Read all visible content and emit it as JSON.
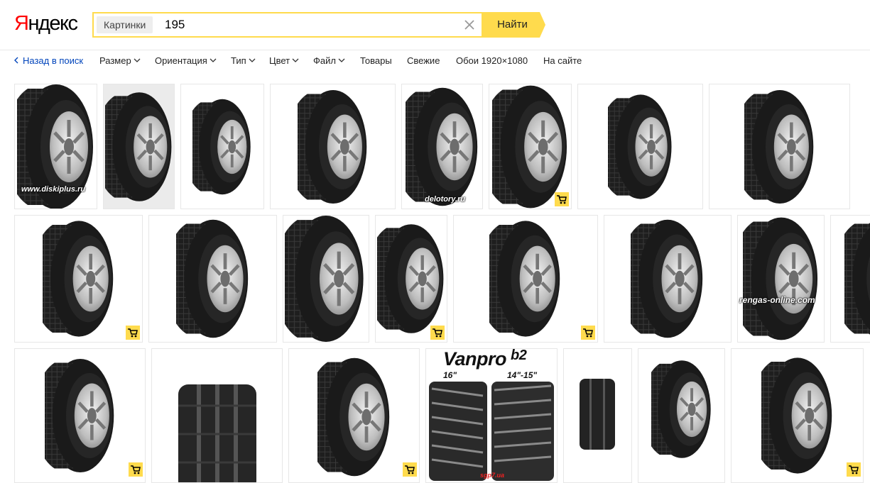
{
  "header": {
    "logo_first": "Я",
    "logo_rest": "ндекс",
    "search_scope": "Картинки",
    "query": "195",
    "clear_icon": "close-icon",
    "find_label": "Найти",
    "accent_color": "#ffdb4d",
    "logo_color": "#ff0000"
  },
  "filters": {
    "back_label": "Назад в поиск",
    "items": [
      {
        "label": "Размер",
        "dropdown": true
      },
      {
        "label": "Ориентация",
        "dropdown": true
      },
      {
        "label": "Тип",
        "dropdown": true
      },
      {
        "label": "Цвет",
        "dropdown": true
      },
      {
        "label": "Файл",
        "dropdown": true
      },
      {
        "label": "Товары",
        "dropdown": false
      },
      {
        "label": "Свежие",
        "dropdown": false
      },
      {
        "label": "Обои 1920×1080",
        "dropdown": false
      },
      {
        "label": "На сайте",
        "dropdown": false
      }
    ]
  },
  "results": {
    "watermarks": {
      "diskiplus": "www.diskiplus.ru",
      "delotory": "delotory.ru",
      "rengas": "rengas-online.com",
      "sgp": "sgp7.ua",
      "vanpro_title": "Vanpro",
      "vanpro_sub": "b2",
      "vanpro_size1": "16\"",
      "vanpro_size2": "14\"-15\""
    },
    "shop_icon": "shopping-cart-icon"
  }
}
